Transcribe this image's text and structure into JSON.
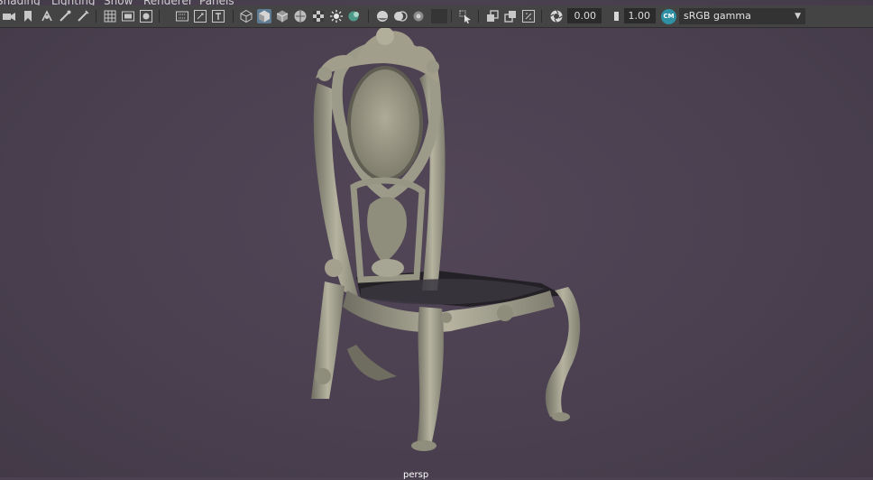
{
  "menu": [
    "Shading",
    "Lighting",
    "Show",
    "Renderer",
    "Panels"
  ],
  "toolbar": {
    "exposure_value": "0.00",
    "gamma_value": "1.00",
    "colorspace_icon_text": "CM",
    "colorspace_value": "sRGB gamma"
  },
  "viewport": {
    "camera_label": "persp",
    "background_color": "#4b4150"
  },
  "scene": {
    "object": "ornate-carved-chair",
    "shading": "smooth-shaded"
  },
  "icons": [
    "camera-icon",
    "bookmark-icon",
    "camera-move-icon",
    "wand-icon",
    "grid-icon",
    "film-gate-icon",
    "resolution-gate-icon",
    "gate-mask-icon",
    "field-chart-icon",
    "safe-action-icon",
    "safe-title-icon",
    "wireframe-icon",
    "smooth-shade-icon",
    "shade-wireframe-icon",
    "textured-icon",
    "lighting-icon",
    "shadows-icon",
    "ambient-occlusion-icon",
    "motion-blur-icon",
    "anti-aliasing-icon",
    "depth-of-field-icon",
    "isolate-select-icon",
    "xray-icon",
    "xray-joints-icon",
    "backface-culling-icon",
    "exposure-icon",
    "gamma-icon"
  ]
}
